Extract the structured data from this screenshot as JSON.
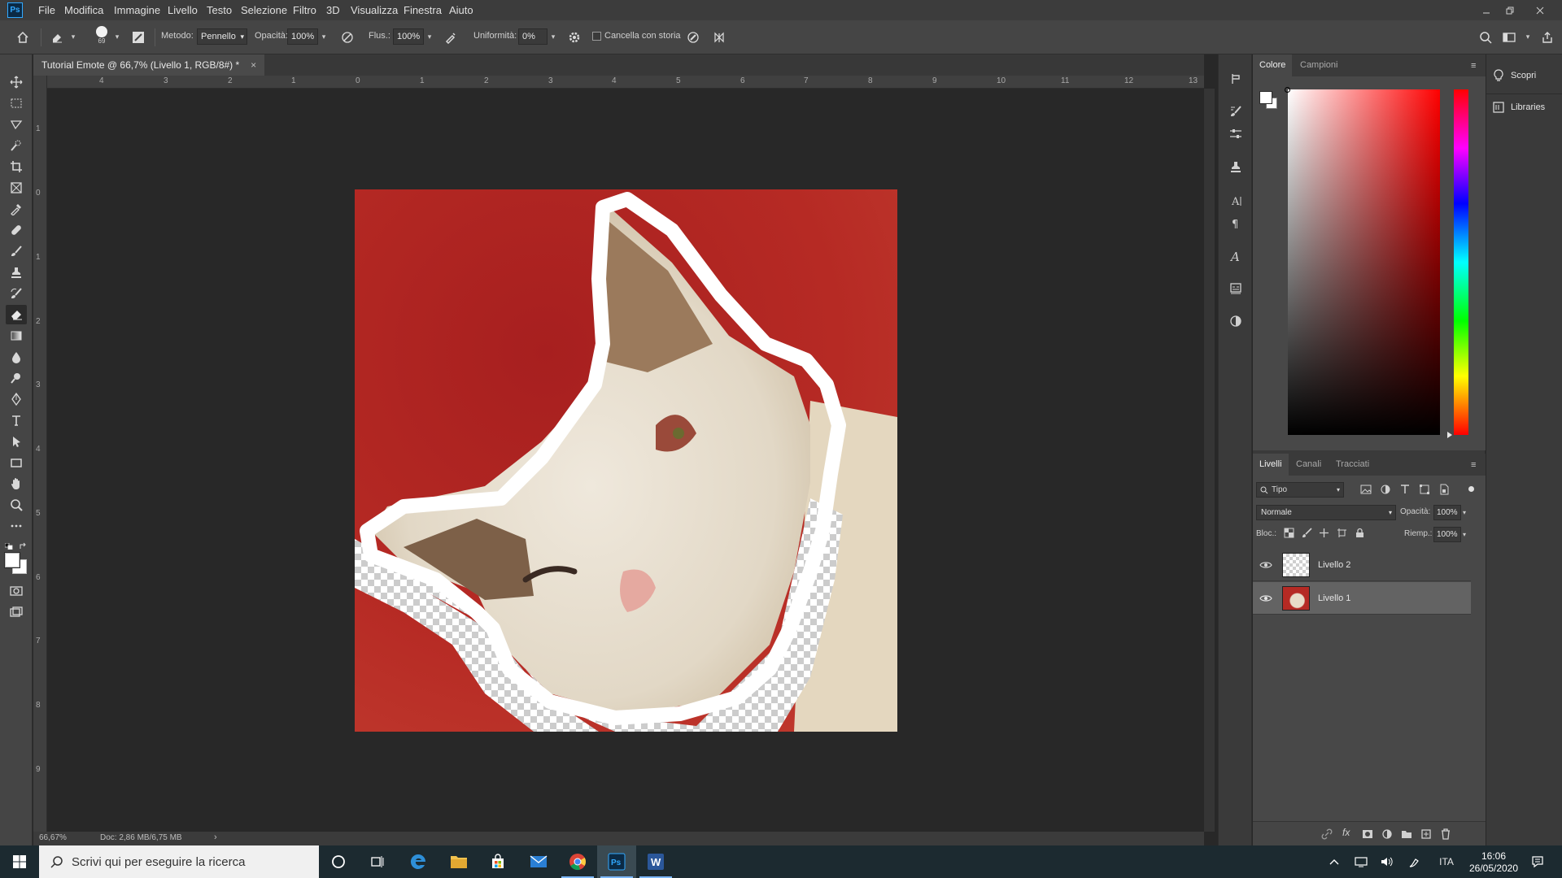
{
  "app": {
    "logo": "Ps"
  },
  "menu": [
    "File",
    "Modifica",
    "Immagine",
    "Livello",
    "Testo",
    "Selezione",
    "Filtro",
    "3D",
    "Visualizza",
    "Finestra",
    "Aiuto"
  ],
  "options": {
    "brush_size": "69",
    "method_label": "Metodo:",
    "method_value": "Pennello",
    "opacity_label": "Opacità:",
    "opacity_value": "100%",
    "flow_label": "Flus.:",
    "flow_value": "100%",
    "smooth_label": "Uniformità:",
    "smooth_value": "0%",
    "history_label": "Cancella con storia"
  },
  "document": {
    "tab_title": "Tutorial Emote @ 66,7% (Livello 1, RGB/8#) *",
    "ruler_top": [
      "4",
      "3",
      "2",
      "1",
      "0",
      "1",
      "2",
      "3",
      "4",
      "5",
      "6",
      "7",
      "8",
      "9",
      "10",
      "11",
      "12",
      "13"
    ],
    "ruler_left": [
      "1",
      "0",
      "1",
      "2",
      "3",
      "4",
      "5",
      "6",
      "7",
      "8",
      "9"
    ],
    "zoom": "66,67%",
    "doc_size": "Doc: 2,86 MB/6,75 MB"
  },
  "color_panel": {
    "tabs": [
      "Colore",
      "Campioni"
    ],
    "hue_color": "#ff0000"
  },
  "layers_panel": {
    "tabs": [
      "Livelli",
      "Canali",
      "Tracciati"
    ],
    "filter": "Tipo",
    "blend_mode": "Normale",
    "opacity_label": "Opacità:",
    "opacity_value": "100%",
    "lock_label": "Bloc.:",
    "fill_label": "Riemp.:",
    "fill_value": "100%",
    "layers": [
      {
        "name": "Livello 2",
        "selected": false
      },
      {
        "name": "Livello 1",
        "selected": true
      }
    ]
  },
  "far_panel": {
    "discover": "Scopri",
    "libraries": "Libraries"
  },
  "taskbar": {
    "search_placeholder": "Scrivi qui per eseguire la ricerca",
    "lang": "ITA",
    "time": "16:06",
    "date": "26/05/2020"
  }
}
